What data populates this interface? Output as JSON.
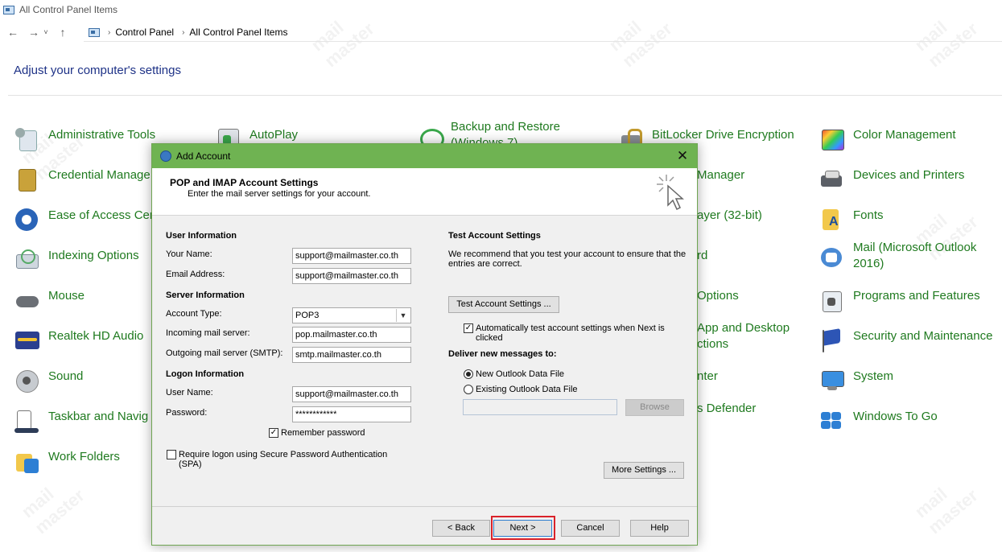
{
  "window": {
    "title": "All Control Panel Items"
  },
  "address": {
    "crumbs": [
      "Control Panel",
      "All Control Panel Items"
    ]
  },
  "heading": "Adjust your computer's settings",
  "items": [
    {
      "label": "Administrative Tools",
      "icon": "administrative-tools-icon"
    },
    {
      "label": "AutoPlay",
      "icon": "autoplay-icon"
    },
    {
      "label": "Backup and Restore (Windows 7)",
      "icon": "backup-restore-icon"
    },
    {
      "label": "BitLocker Drive Encryption",
      "icon": "bitlocker-icon"
    },
    {
      "label": "Color Management",
      "icon": "color-management-icon"
    },
    {
      "label": "Credential Manage",
      "icon": "credential-manager-icon"
    },
    {
      "label": "Manager",
      "icon": ""
    },
    {
      "label": "Devices and Printers",
      "icon": "devices-printers-icon"
    },
    {
      "label": "Ease of Access Cen",
      "icon": "ease-of-access-icon"
    },
    {
      "label": "ayer (32-bit)",
      "icon": ""
    },
    {
      "label": "Fonts",
      "icon": "fonts-icon"
    },
    {
      "label": "Indexing Options",
      "icon": "indexing-options-icon"
    },
    {
      "label": "rd",
      "icon": ""
    },
    {
      "label": "Mail (Microsoft Outlook 2016)",
      "icon": "mail-icon"
    },
    {
      "label": "Mouse",
      "icon": "mouse-icon"
    },
    {
      "label": "Options",
      "icon": ""
    },
    {
      "label": "Programs and Features",
      "icon": "programs-features-icon"
    },
    {
      "label": "Realtek HD Audio",
      "icon": "realtek-audio-icon"
    },
    {
      "label": "App and Desktop ctions",
      "icon": ""
    },
    {
      "label": "Security and Maintenance",
      "icon": "security-maintenance-icon"
    },
    {
      "label": "Sound",
      "icon": "sound-icon"
    },
    {
      "label": "nter",
      "icon": ""
    },
    {
      "label": "System",
      "icon": "system-icon"
    },
    {
      "label": "Taskbar and Navig",
      "icon": "taskbar-icon"
    },
    {
      "label": "s Defender",
      "icon": ""
    },
    {
      "label": "Windows To Go",
      "icon": "windows-to-go-icon"
    },
    {
      "label": "Work Folders",
      "icon": "work-folders-icon"
    }
  ],
  "dialog": {
    "title": "Add Account",
    "header_title": "POP and IMAP Account Settings",
    "header_subtitle": "Enter the mail server settings for your account.",
    "user_info": "User Information",
    "your_name_label": "Your Name:",
    "your_name": "support@mailmaster.co.th",
    "email_label": "Email Address:",
    "email": "support@mailmaster.co.th",
    "server_info": "Server Information",
    "account_type_label": "Account Type:",
    "account_type": "POP3",
    "incoming_label": "Incoming mail server:",
    "incoming": "pop.mailmaster.co.th",
    "outgoing_label": "Outgoing mail server (SMTP):",
    "outgoing": "smtp.mailmaster.co.th",
    "logon_info": "Logon Information",
    "username_label": "User Name:",
    "username": "support@mailmaster.co.th",
    "password_label": "Password:",
    "password": "************",
    "remember_password": "Remember password",
    "spa": "Require logon using Secure Password Authentication (SPA)",
    "test_title": "Test Account Settings",
    "test_desc": "We recommend that you test your account to ensure that the entries are correct.",
    "test_button": "Test Account Settings ...",
    "auto_test": "Automatically test account settings when Next is clicked",
    "deliver_title": "Deliver new messages to:",
    "new_data_file": "New Outlook Data File",
    "existing_data_file": "Existing Outlook Data File",
    "browse": "Browse",
    "more_settings": "More Settings ...",
    "back": "< Back",
    "next": "Next >",
    "cancel": "Cancel",
    "help": "Help"
  },
  "colors": {
    "accent": "#6fb352",
    "link_green": "#1f7a1f",
    "heading_blue": "#1e3287",
    "highlight_red": "#d9222a"
  }
}
